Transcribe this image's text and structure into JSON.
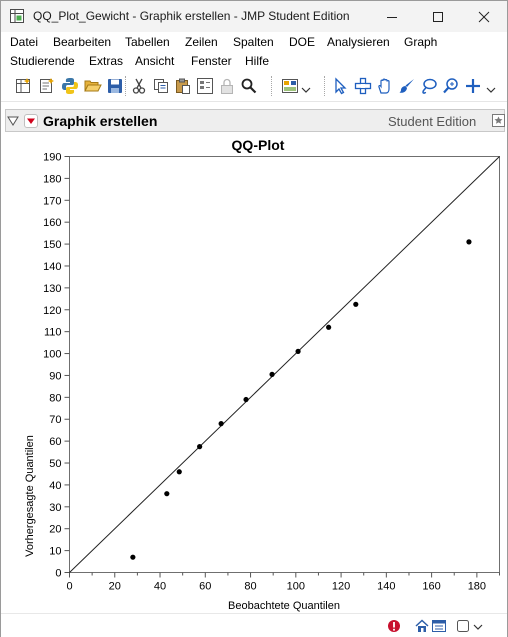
{
  "window": {
    "title": "QQ_Plot_Gewicht - Graphik erstellen - JMP Student Edition"
  },
  "menu": {
    "items": [
      "Datei",
      "Bearbeiten",
      "Tabellen",
      "Zeilen",
      "Spalten",
      "DOE",
      "Analysieren",
      "Graph",
      "Studierende",
      "Extras",
      "Ansicht",
      "Fenster",
      "Hilfe"
    ]
  },
  "toolbar": {
    "icons": [
      "new-data-table-icon",
      "new-script-icon",
      "python-icon",
      "open-folder-icon",
      "save-icon",
      "cut-icon",
      "copy-icon",
      "paste-icon",
      "data-view-icon",
      "lock-icon",
      "search-icon",
      "dashboard-icon",
      "arrow-tool-icon",
      "crosshair-tool-icon",
      "hand-tool-icon",
      "brush-tool-icon",
      "lasso-tool-icon",
      "magnifier-tool-icon",
      "plus-tool-icon"
    ]
  },
  "report": {
    "title": "Graphik erstellen",
    "edition": "Student Edition"
  },
  "colors": {
    "titlebar_bg": "#f3f3f3",
    "header_bg": "#eeeeee",
    "accent_red": "#d0021b",
    "toolbar_blue": "#1f5fbf"
  },
  "chart_data": {
    "type": "scatter",
    "title": "QQ-Plot",
    "xlabel": "Beobachtete Quantilen",
    "ylabel": "Vorhergesagte Quantilen",
    "xlim": [
      0,
      190
    ],
    "ylim": [
      0,
      190
    ],
    "x_ticks": [
      "0",
      "20",
      "40",
      "60",
      "80",
      "100",
      "120",
      "140",
      "160",
      "180"
    ],
    "y_ticks": [
      "0",
      "10",
      "20",
      "30",
      "40",
      "50",
      "60",
      "70",
      "80",
      "90",
      "100",
      "110",
      "120",
      "130",
      "140",
      "150",
      "160",
      "170",
      "180",
      "190"
    ],
    "reference_line": {
      "from": [
        0,
        0
      ],
      "to": [
        190,
        190
      ]
    },
    "grid": false,
    "points": [
      {
        "x": 28,
        "y": 7
      },
      {
        "x": 43,
        "y": 36
      },
      {
        "x": 48.5,
        "y": 46
      },
      {
        "x": 57.5,
        "y": 57.5
      },
      {
        "x": 67,
        "y": 68
      },
      {
        "x": 78,
        "y": 79
      },
      {
        "x": 89.5,
        "y": 90.5
      },
      {
        "x": 101,
        "y": 101
      },
      {
        "x": 114.5,
        "y": 112
      },
      {
        "x": 126.5,
        "y": 122.5
      },
      {
        "x": 176.5,
        "y": 151
      }
    ]
  }
}
